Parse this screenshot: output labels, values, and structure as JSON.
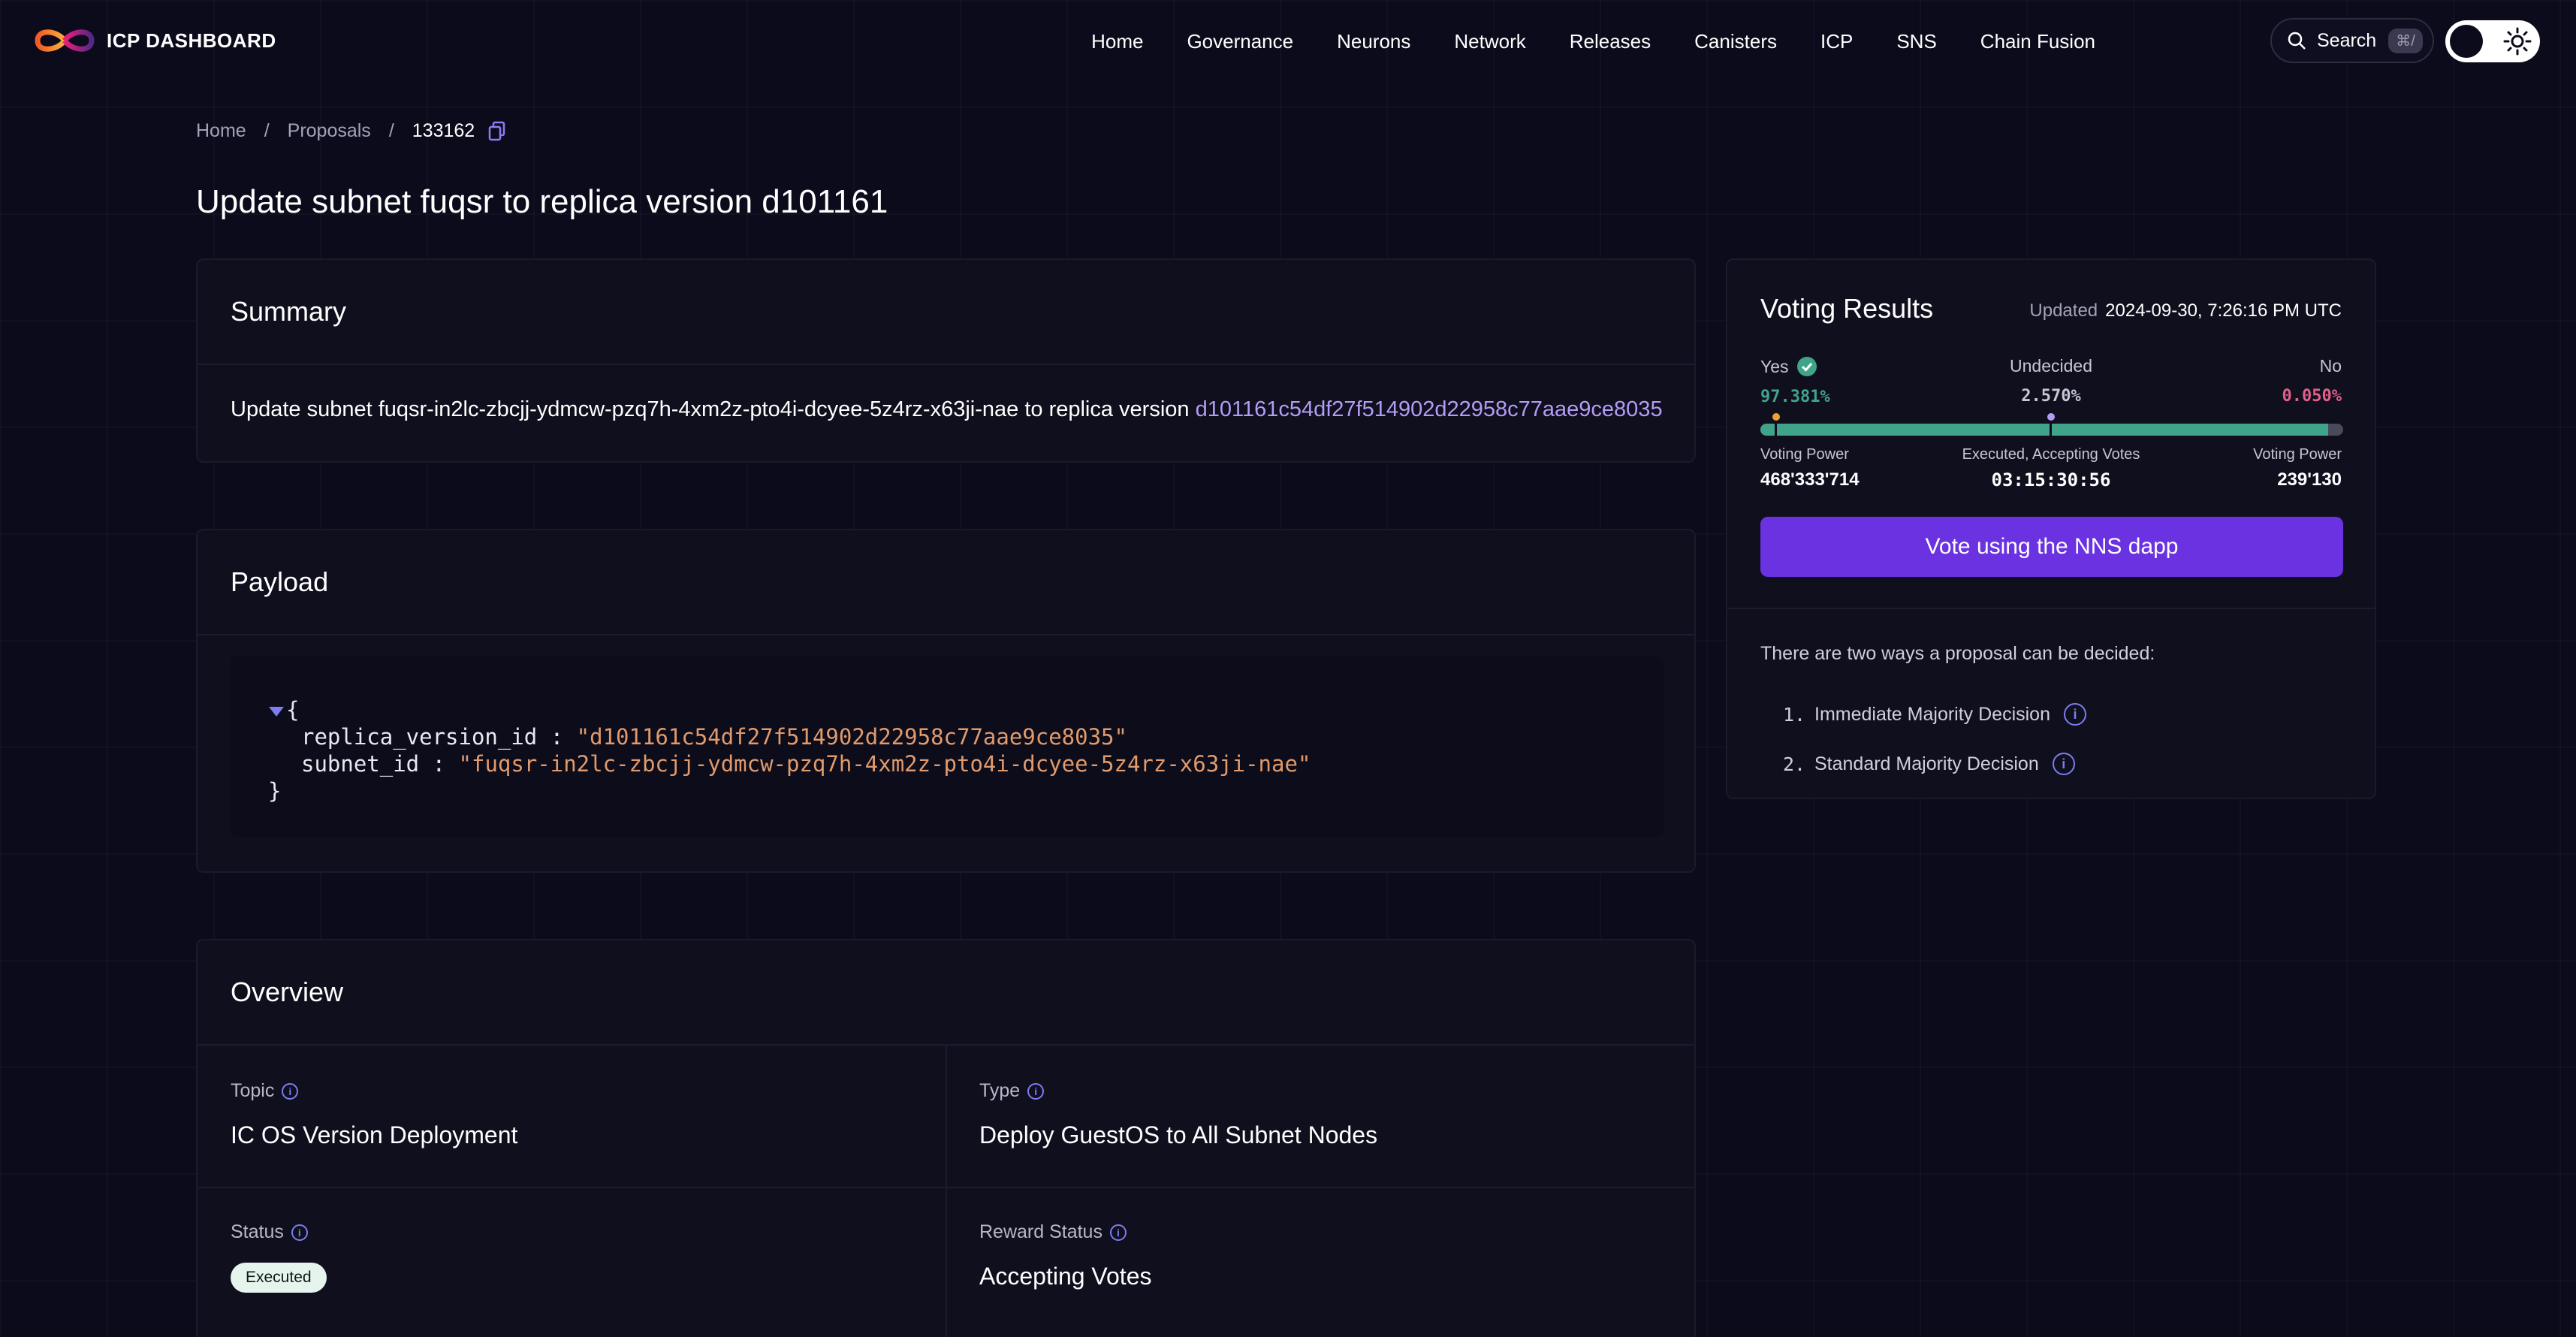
{
  "nav": {
    "logo_text": "ICP DASHBOARD",
    "links": [
      "Home",
      "Governance",
      "Neurons",
      "Network",
      "Releases",
      "Canisters",
      "ICP",
      "SNS",
      "Chain Fusion"
    ],
    "search_label": "Search",
    "search_shortcut": "⌘/"
  },
  "breadcrumb": {
    "home": "Home",
    "proposals": "Proposals",
    "current": "133162"
  },
  "page_title": "Update subnet fuqsr to replica version d101161",
  "summary": {
    "heading": "Summary",
    "text": "Update subnet fuqsr-in2lc-zbcjj-ydmcw-pzq7h-4xm2z-pto4i-dcyee-5z4rz-x63ji-nae to replica version ",
    "hash": "d101161c54df27f514902d22958c77aae9ce8035"
  },
  "payload": {
    "heading": "Payload",
    "open_brace": "{",
    "close_brace": "}",
    "fields": [
      {
        "key": "replica_version_id",
        "value": "\"d101161c54df27f514902d22958c77aae9ce8035\""
      },
      {
        "key": "subnet_id",
        "value": "\"fuqsr-in2lc-zbcjj-ydmcw-pzq7h-4xm2z-pto4i-dcyee-5z4rz-x63ji-nae\""
      }
    ]
  },
  "overview": {
    "heading": "Overview",
    "topic_label": "Topic",
    "topic_value": "IC OS Version Deployment",
    "type_label": "Type",
    "type_value": "Deploy GuestOS to All Subnet Nodes",
    "status_label": "Status",
    "status_value": "Executed",
    "reward_label": "Reward Status",
    "reward_value": "Accepting Votes"
  },
  "voting": {
    "title": "Voting Results",
    "updated_label": "Updated",
    "updated_value": "2024-09-30, 7:26:16 PM UTC",
    "yes_label": "Yes",
    "yes_pct": "97.381%",
    "undecided_label": "Undecided",
    "undecided_pct": "2.570%",
    "no_label": "No",
    "no_pct": "0.050%",
    "yes_fraction": 0.97381,
    "no_fraction": 0.0005,
    "yes_vp_label": "Voting Power",
    "yes_vp": "468'333'714",
    "status_label": "Executed, Accepting Votes",
    "status_time": "03:15:30:56",
    "no_vp_label": "Voting Power",
    "no_vp": "239'130",
    "button": "Vote using the NNS dapp",
    "ways_intro": "There are two ways a proposal can be decided:",
    "ways": [
      "Immediate Majority Decision",
      "Standard Majority Decision"
    ]
  },
  "colors": {
    "accent": "#6a32e0",
    "yes": "#3fa48a",
    "no": "#e0608a",
    "link": "#b49cf5"
  }
}
